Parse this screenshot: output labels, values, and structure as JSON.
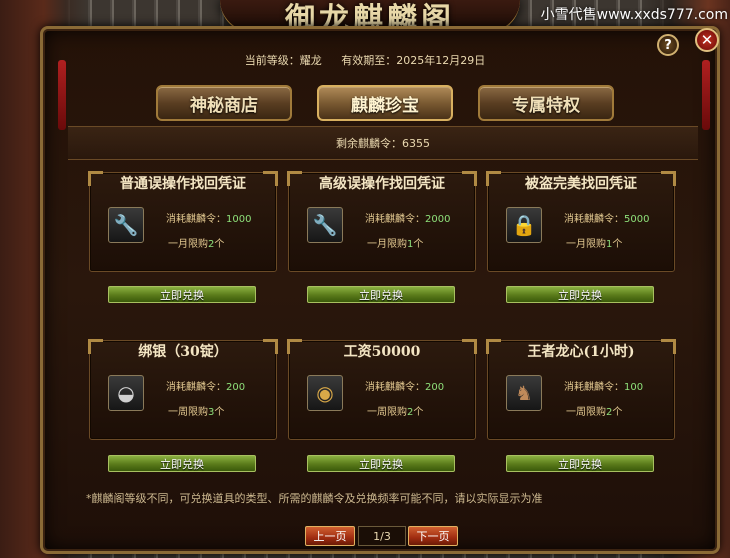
{
  "window": {
    "banner_title": "御龙麒麟阁",
    "site_tag": "小雪代售www.xxds777.com"
  },
  "info": {
    "level": "当前等级：耀龙",
    "expiry": "有效期至：2025年12月29日"
  },
  "controls": {
    "help": "?",
    "close": "✕"
  },
  "tabs": [
    {
      "label": "神秘商店",
      "active": false
    },
    {
      "label": "麒麟珍宝",
      "active": true
    },
    {
      "label": "专属特权",
      "active": false
    }
  ],
  "remaining": "剩余麒麟令：6355",
  "cost_label": "消耗麒麟令：",
  "exchange_label": "立即兑换",
  "items": [
    {
      "title": "普通误操作找回凭证",
      "icon": "wrench-icon",
      "glyph": "🔧",
      "cost": "1000",
      "limit_prefix": "一月限购",
      "limit_num": "2",
      "limit_suffix": "个"
    },
    {
      "title": "高级误操作找回凭证",
      "icon": "wrench-icon",
      "glyph": "🔧",
      "cost": "2000",
      "limit_prefix": "一月限购",
      "limit_num": "1",
      "limit_suffix": "个"
    },
    {
      "title": "被盗完美找回凭证",
      "icon": "lock-icon",
      "glyph": "🔒",
      "cost": "5000",
      "limit_prefix": "一月限购",
      "limit_num": "1",
      "limit_suffix": "个"
    },
    {
      "title": "绑银（30锭）",
      "icon": "silver-ingot-icon",
      "glyph": "◒",
      "cost": "200",
      "limit_prefix": "一周限购",
      "limit_num": "3",
      "limit_suffix": "个"
    },
    {
      "title": "工资50000",
      "icon": "gold-coins-icon",
      "glyph": "◉",
      "cost": "200",
      "limit_prefix": "一周限购",
      "limit_num": "2",
      "limit_suffix": "个"
    },
    {
      "title": "王者龙心(1小时)",
      "icon": "dragon-heart-icon",
      "glyph": "♞",
      "cost": "100",
      "limit_prefix": "一周限购",
      "limit_num": "2",
      "limit_suffix": "个"
    }
  ],
  "note": "*麒麟阁等级不同，可兑换道具的类型、所需的麒麟令及兑换频率可能不同，请以实际显示为准",
  "pager": {
    "prev": "上一页",
    "page": "1/3",
    "next": "下一页"
  }
}
